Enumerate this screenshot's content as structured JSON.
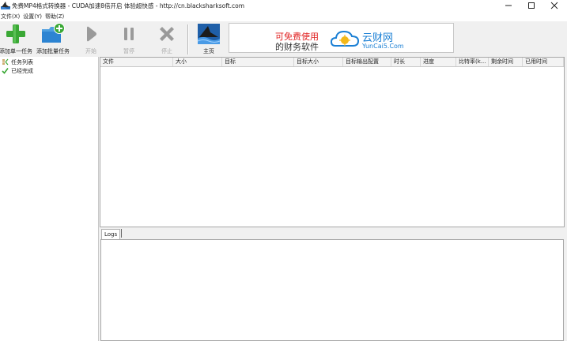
{
  "window": {
    "title": "免费MP4格式转换器 - CUDA加速8倍开启 体验超快感 - http://cn.blacksharksoft.com",
    "controls": {
      "minimize": "minimize",
      "maximize": "maximize",
      "close": "close"
    }
  },
  "menu": {
    "items": [
      {
        "label": "文件(X)"
      },
      {
        "label": "设置(Y)"
      },
      {
        "label": "帮助(Z)"
      }
    ]
  },
  "toolbar": {
    "add_single": {
      "label": "添加单一任务",
      "icon": "add-plus-icon",
      "enabled": true
    },
    "add_batch": {
      "label": "添加批量任务",
      "icon": "folder-add-icon",
      "enabled": true
    },
    "start": {
      "label": "开始",
      "icon": "play-icon",
      "enabled": false
    },
    "pause": {
      "label": "暂停",
      "icon": "pause-icon",
      "enabled": false
    },
    "stop": {
      "label": "停止",
      "icon": "stop-x-icon",
      "enabled": false
    },
    "home": {
      "label": "主页",
      "icon": "shark-logo-icon",
      "enabled": true
    }
  },
  "ad": {
    "line1_red": "可免费使用",
    "line2": "的财务软件",
    "brand": "云财网",
    "domain": "YunCai5.Com"
  },
  "tree": {
    "items": [
      {
        "label": "任务列表",
        "icon": "task-list-icon"
      },
      {
        "label": "已经完成",
        "icon": "check-icon"
      }
    ]
  },
  "task_table": {
    "columns": [
      {
        "label": "文件"
      },
      {
        "label": "大小"
      },
      {
        "label": "目标"
      },
      {
        "label": "目标大小"
      },
      {
        "label": "目标输出配置"
      },
      {
        "label": "时长"
      },
      {
        "label": "进度"
      },
      {
        "label": "比特率(k..."
      },
      {
        "label": "剩余时间"
      },
      {
        "label": "已用时间"
      }
    ],
    "rows": []
  },
  "logs": {
    "tab_label": "Logs",
    "content": ""
  },
  "colors": {
    "accent_green": "#3aa835",
    "brand_blue": "#1a7fd4",
    "ad_red": "#e02020"
  }
}
